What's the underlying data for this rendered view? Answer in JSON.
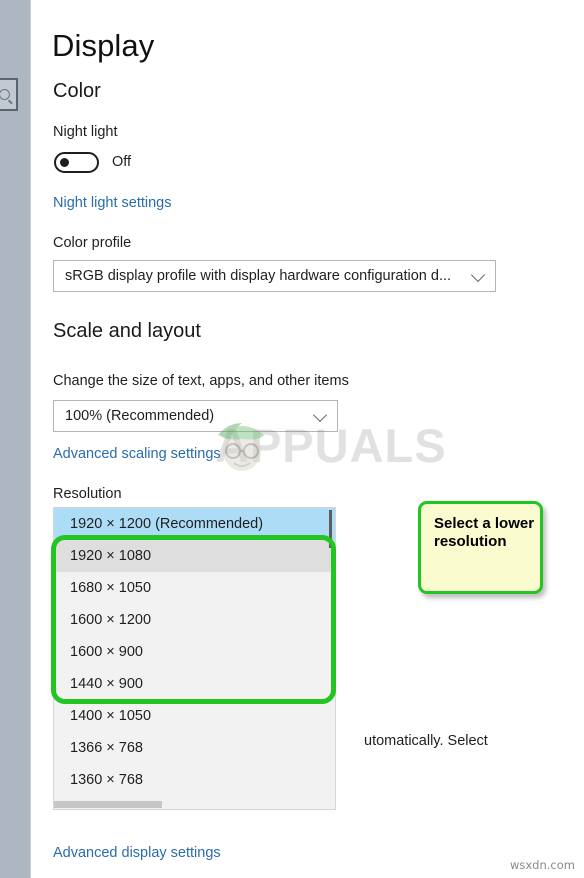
{
  "window": {
    "page_title": "Display"
  },
  "left_rail": {
    "search_icon": "search-icon"
  },
  "color_section": {
    "heading": "Color",
    "night_light_label": "Night light",
    "night_light_state": "Off",
    "night_light_settings_link": "Night light settings",
    "color_profile_label": "Color profile",
    "color_profile_value": "sRGB display profile with display hardware configuration d...",
    "chevron_icon": "chevron-down-icon"
  },
  "scale_section": {
    "heading": "Scale and layout",
    "change_size_label": "Change the size of text, apps, and other items",
    "scale_value": "100% (Recommended)",
    "advanced_scaling_link": "Advanced scaling settings",
    "resolution_label": "Resolution",
    "resolution_options": [
      {
        "label": "1920 × 1200 (Recommended)",
        "state": "selected"
      },
      {
        "label": "1920 × 1080",
        "state": "hovered"
      },
      {
        "label": "1680 × 1050",
        "state": "normal"
      },
      {
        "label": "1600 × 1200",
        "state": "normal"
      },
      {
        "label": "1600 × 900",
        "state": "normal"
      },
      {
        "label": "1440 × 900",
        "state": "normal"
      },
      {
        "label": "1400 × 1050",
        "state": "normal"
      },
      {
        "label": "1366 × 768",
        "state": "normal"
      },
      {
        "label": "1360 × 768",
        "state": "normal"
      }
    ],
    "obscured_body_text": "utomatically. Select"
  },
  "footer": {
    "advanced_display_link": "Advanced display settings"
  },
  "annotation": {
    "callout_text": "Select a lower resolution",
    "highlight_color": "#22c522",
    "callout_bg": "#fbfbd0"
  },
  "watermarks": {
    "brand": "APPUALS",
    "source": "wsxdn.com"
  }
}
